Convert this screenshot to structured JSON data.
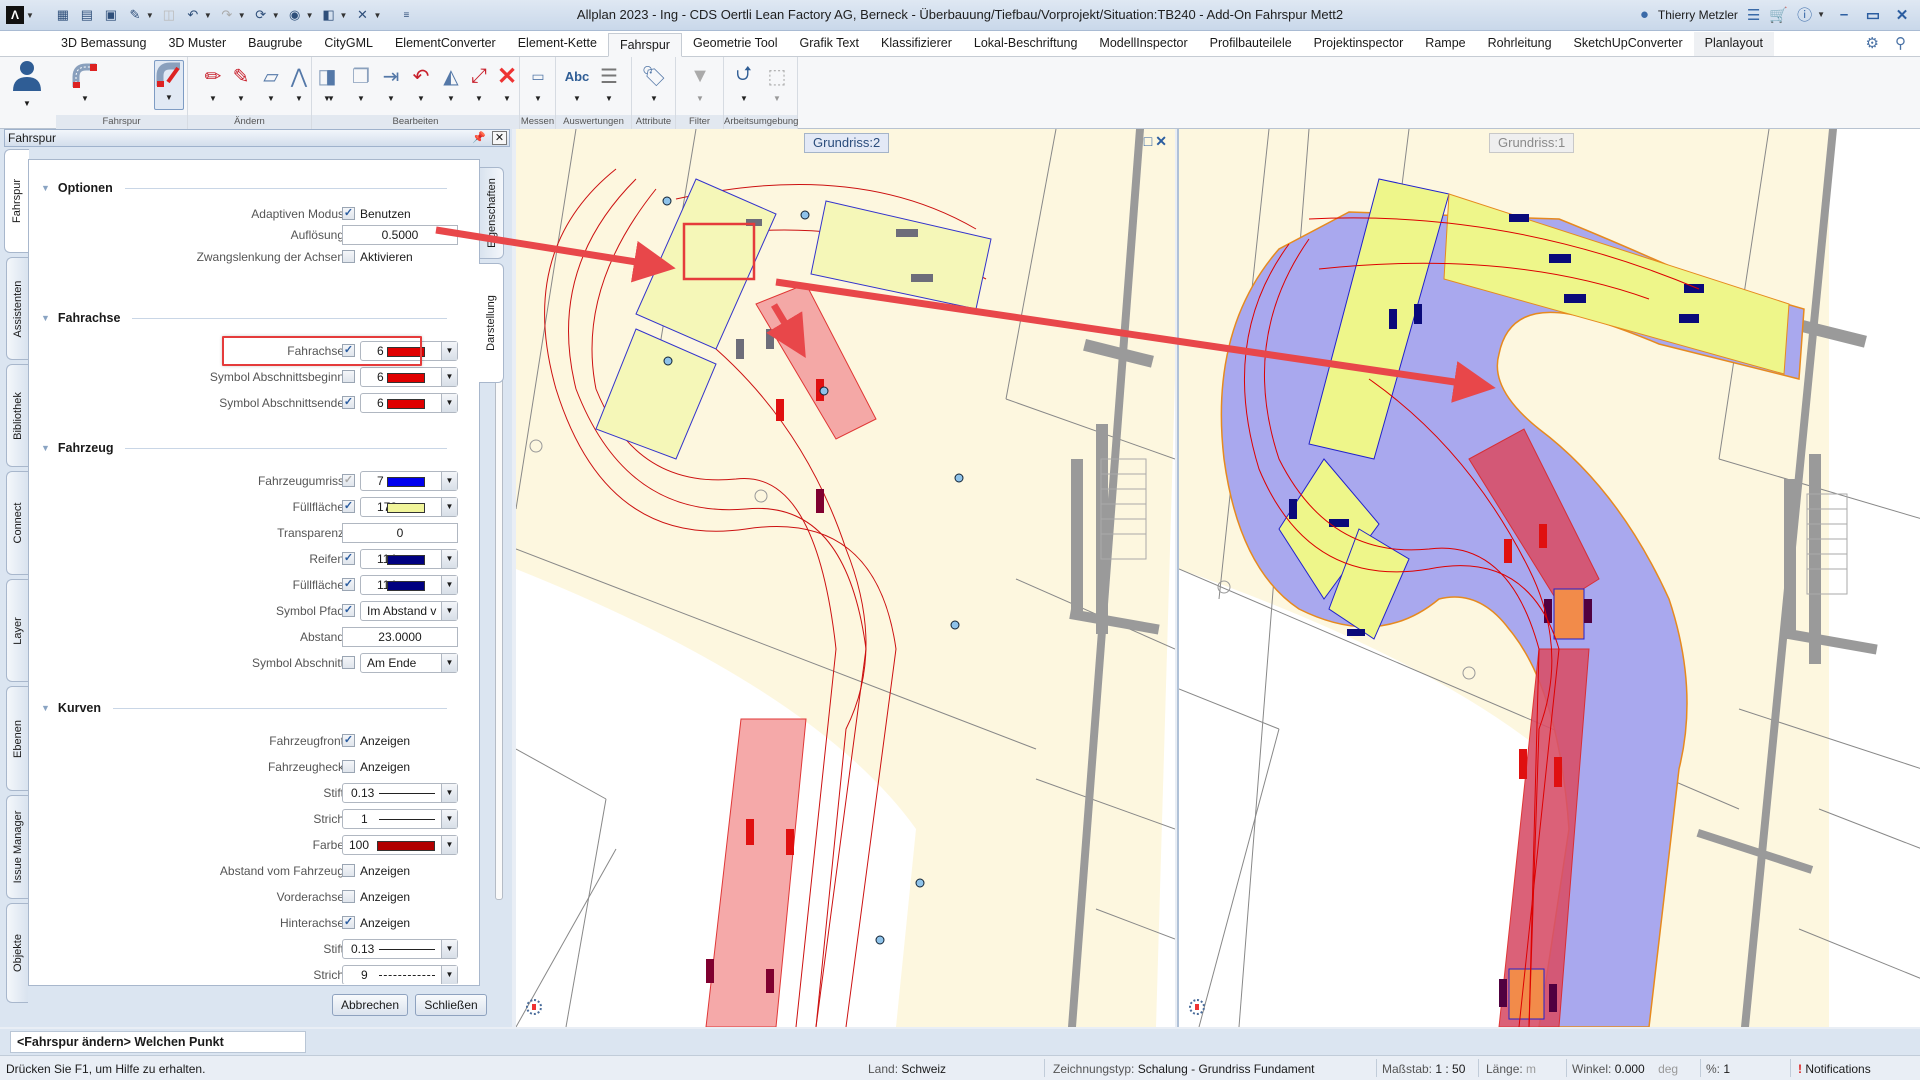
{
  "window": {
    "title": "Allplan 2023 - Ing - CDS Oertli Lean Factory AG, Berneck - Überbauung/Tiefbau/Vorprojekt/Situation:TB240 - Add-On Fahrspur Mett2",
    "user": "Thierry Metzler",
    "app_logo": "Λ"
  },
  "ribbon": {
    "tabs": [
      "3D Bemassung",
      "3D Muster",
      "Baugrube",
      "CityGML",
      "ElementConverter",
      "Element-Kette",
      "Fahrspur",
      "Geometrie Tool",
      "Grafik Text",
      "Klassifizierer",
      "Lokal-Beschriftung",
      "ModellInspector",
      "Profilbauteilele",
      "Projektinspector",
      "Rampe",
      "Rohrleitung",
      "SketchUpConverter",
      "Planlayout"
    ],
    "active_tab": "Fahrspur",
    "groups": [
      "Fahrspur",
      "Ändern",
      "Bearbeiten",
      "Messen",
      "Auswertungen",
      "Attribute",
      "Filter",
      "Arbeitsumgebung"
    ],
    "abc_label": "Abc"
  },
  "panel": {
    "title": "Fahrspur",
    "side_tabs": [
      "Fahrspur",
      "Assistenten",
      "Bibliothek",
      "Connect",
      "Layer",
      "Ebenen",
      "Issue Manager",
      "Objekte"
    ],
    "right_tabs": [
      "Eigenschaften",
      "Darstellung"
    ],
    "sections": {
      "optionen": "Optionen",
      "fahrachse": "Fahrachse",
      "fahrzeug": "Fahrzeug",
      "kurven": "Kurven"
    },
    "optionen": {
      "adaptiven_label": "Adaptiven Modus",
      "adaptiven_text": "Benutzen",
      "adaptiven_checked": true,
      "aufloesung_label": "Auflösung",
      "aufloesung_value": "0.5000",
      "zwangs_label": "Zwangslenkung der Achsen",
      "zwangs_text": "Aktivieren",
      "zwangs_checked": false
    },
    "fahrachse": [
      {
        "label": "Fahrachse",
        "checked": true,
        "value": "6",
        "color": "#e00000"
      },
      {
        "label": "Symbol Abschnittsbeginn",
        "checked": false,
        "value": "6",
        "color": "#e00000"
      },
      {
        "label": "Symbol Abschnittsende",
        "checked": true,
        "value": "6",
        "color": "#e00000"
      }
    ],
    "fahrzeug": {
      "umriss": {
        "label": "Fahrzeugumriss",
        "checked": true,
        "value": "7",
        "color": "#0000ee"
      },
      "fuell": {
        "label": "Füllfläche",
        "checked": true,
        "value": "172",
        "color": "#f1f59a"
      },
      "transparenz": {
        "label": "Transparenz",
        "value": "0"
      },
      "reifen": {
        "label": "Reifen",
        "checked": true,
        "value": "114",
        "color": "#000080"
      },
      "fuell2": {
        "label": "Füllfläche",
        "checked": true,
        "value": "114",
        "color": "#000080"
      },
      "symbol_pfad": {
        "label": "Symbol Pfad",
        "checked": true,
        "value": "Im Abstand v"
      },
      "abstand": {
        "label": "Abstand",
        "value": "23.0000"
      },
      "symbol_abschnitt": {
        "label": "Symbol Abschnitt",
        "checked": false,
        "value": "Am Ende"
      }
    },
    "kurven": {
      "front": {
        "label": "Fahrzeugfront",
        "text": "Anzeigen",
        "checked": true
      },
      "heck": {
        "label": "Fahrzeugheck",
        "text": "Anzeigen",
        "checked": false
      },
      "stift": {
        "label": "Stift",
        "value": "0.13"
      },
      "strich": {
        "label": "Strich",
        "value": "1"
      },
      "farbe": {
        "label": "Farbe",
        "value": "100",
        "color": "#b00000"
      },
      "abstand": {
        "label": "Abstand vom Fahrzeug",
        "text": "Anzeigen",
        "checked": false
      },
      "vorder": {
        "label": "Vorderachse",
        "text": "Anzeigen",
        "checked": false
      },
      "hinter": {
        "label": "Hinterachse",
        "text": "Anzeigen",
        "checked": true
      },
      "stift2": {
        "label": "Stift",
        "value": "0.13"
      },
      "strich2": {
        "label": "Strich",
        "value": "9"
      }
    },
    "buttons": {
      "cancel": "Abbrechen",
      "close": "Schließen"
    }
  },
  "viewports": {
    "left_label": "Grundriss:2",
    "right_label": "Grundriss:1"
  },
  "command": {
    "prompt": "<Fahrspur ändern> Welchen Punkt verschieben?"
  },
  "status": {
    "help": "Drücken Sie F1, um Hilfe zu erhalten.",
    "land_k": "Land:",
    "land_v": "Schweiz",
    "ztyp_k": "Zeichnungstyp:",
    "ztyp_v": "Schalung  -  Grundriss Fundament",
    "massstab_k": "Maßstab:",
    "massstab_v": "1 : 50",
    "laenge_k": "Länge:",
    "laenge_v": "m",
    "winkel_k": "Winkel:",
    "winkel_v": "0.000",
    "winkel_u": "deg",
    "pct_k": "%:",
    "pct_v": "1",
    "notifications": "Notifications"
  },
  "colors": {
    "accent": "#2b5da0",
    "highlight": "#e53b3b",
    "plan_bg": "#fdf7df",
    "swept": "#a9a8ee",
    "vehicle": "#f1f59a"
  }
}
